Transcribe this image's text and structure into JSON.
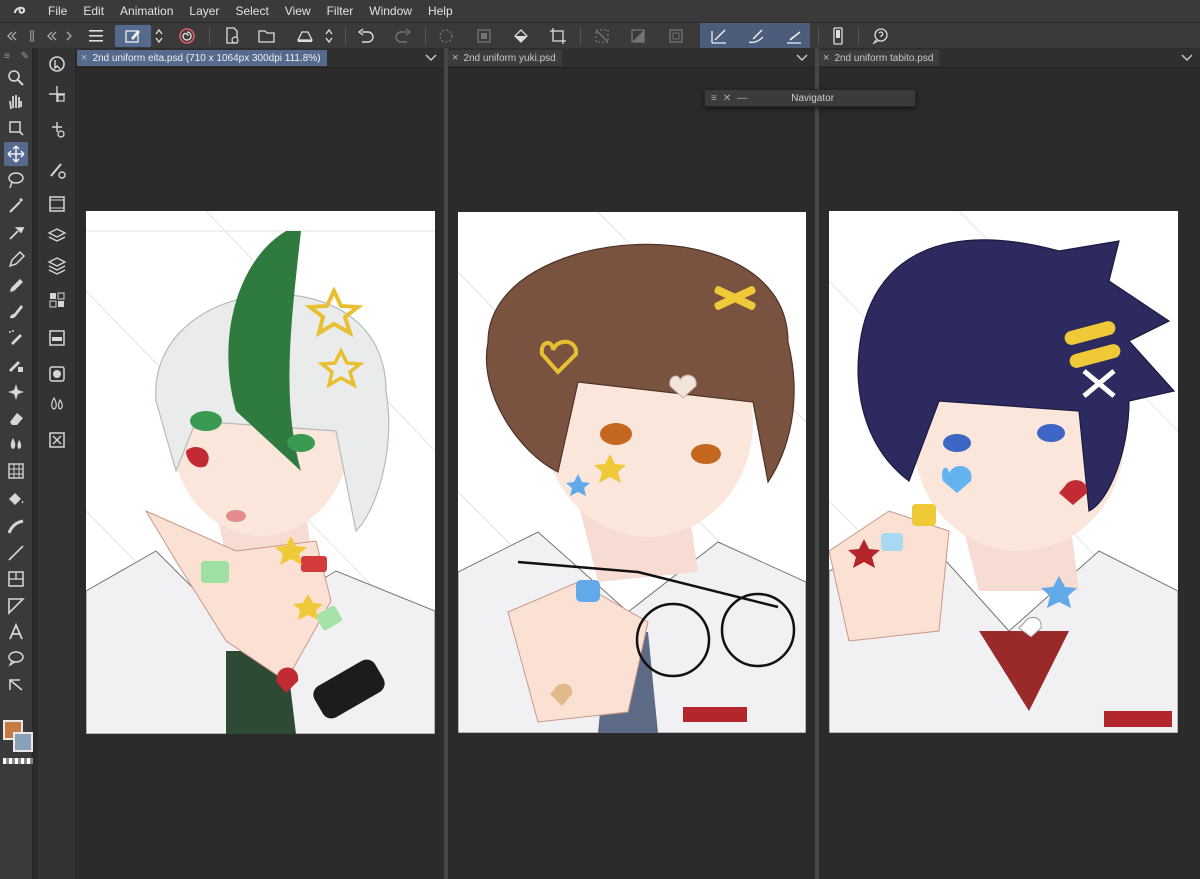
{
  "menu": {
    "items": [
      "File",
      "Edit",
      "Animation",
      "Layer",
      "Select",
      "View",
      "Filter",
      "Window",
      "Help"
    ]
  },
  "tabs": [
    {
      "label": "2nd uniform eita.psd (710 x 1064px 300dpi 111.8%)",
      "active": true
    },
    {
      "label": "2nd uniform yuki.psd",
      "active": false
    },
    {
      "label": "2nd uniform tabito.psd",
      "active": false
    }
  ],
  "navigator": {
    "title": "Navigator"
  },
  "colors": {
    "main": "#c87a45",
    "sub": "#8aa0b8",
    "accent": "#566a8e"
  },
  "icons": {
    "tools": [
      "zoom-icon",
      "hand-icon",
      "rotate-3d-icon",
      "move-icon",
      "lasso-icon",
      "magic-wand-icon",
      "eyedropper-icon",
      "pen-icon",
      "pencil-icon",
      "brush-icon",
      "airbrush-icon",
      "decoration-icon",
      "blend-icon",
      "eraser-icon",
      "watercolor-icon",
      "ruler-icon",
      "fill-icon",
      "gradient-icon",
      "line-icon",
      "frame-icon",
      "figure-icon",
      "text-icon",
      "balloon-icon",
      "correct-line-icon"
    ],
    "subtools": [
      "object-select-icon",
      "layer-move-icon",
      "transform-icon",
      "brush-settings-icon",
      "animation-cel-icon",
      "layer-property-icon",
      "layer-stack-icon",
      "material-icon",
      "panel-layout-icon",
      "mask-icon",
      "color-set-icon",
      "delete-layer-icon"
    ]
  }
}
